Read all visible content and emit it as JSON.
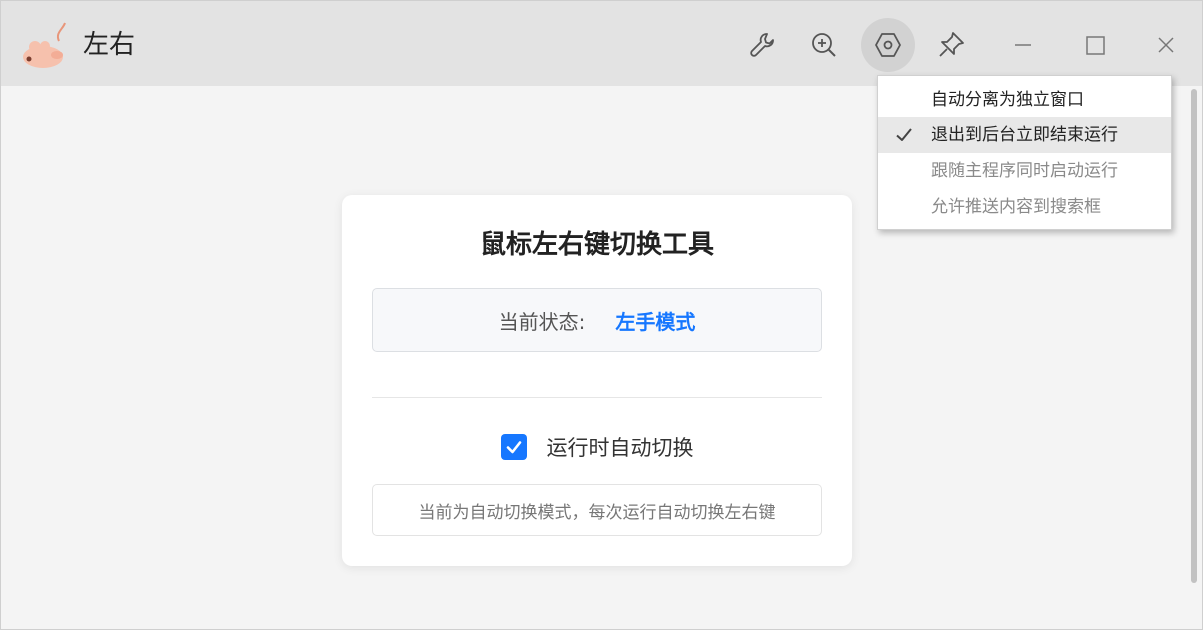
{
  "titlebar": {
    "app_title": "左右",
    "buttons": [
      {
        "name": "wrench-icon"
      },
      {
        "name": "zoom-in-icon"
      },
      {
        "name": "settings-hexagon-icon"
      },
      {
        "name": "pin-icon"
      },
      {
        "name": "minimize-icon"
      },
      {
        "name": "maximize-icon"
      },
      {
        "name": "close-icon"
      }
    ]
  },
  "card": {
    "title": "鼠标左右键切换工具",
    "status_label": "当前状态:",
    "status_value": "左手模式",
    "checkbox_label": "运行时自动切换",
    "checkbox_checked": true,
    "hint": "当前为自动切换模式，每次运行自动切换左右键"
  },
  "menu": {
    "items": [
      {
        "label": "自动分离为独立窗口",
        "checked": false,
        "enabled": true
      },
      {
        "label": "退出到后台立即结束运行",
        "checked": true,
        "enabled": true
      },
      {
        "label": "跟随主程序同时启动运行",
        "checked": false,
        "enabled": false
      },
      {
        "label": "允许推送内容到搜索框",
        "checked": false,
        "enabled": false
      }
    ]
  },
  "colors": {
    "accent": "#1677ff",
    "titlebar_bg": "#e3e3e3",
    "page_bg": "#f4f4f4"
  }
}
